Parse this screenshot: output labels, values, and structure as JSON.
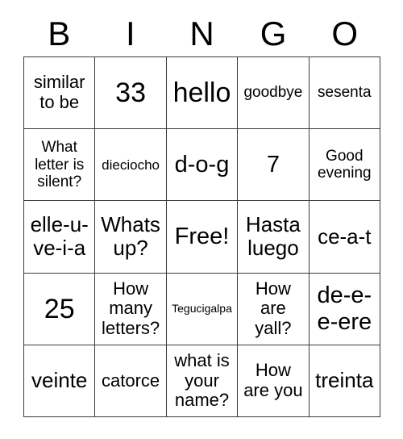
{
  "card": {
    "type": "bingo-card",
    "columns": 5,
    "rows": 5,
    "background_color": "#ffffff",
    "text_color": "#000000",
    "border_color": "#3a3a3a"
  },
  "header": {
    "letters": [
      "B",
      "I",
      "N",
      "G",
      "O"
    ]
  },
  "grid": {
    "rows": [
      [
        {
          "text": "similar to be",
          "size": "lg"
        },
        {
          "text": "33",
          "size": "huge"
        },
        {
          "text": "hello",
          "size": "huge"
        },
        {
          "text": "goodbye",
          "size": "md"
        },
        {
          "text": "sesenta",
          "size": "md"
        }
      ],
      [
        {
          "text": "What letter is silent?",
          "size": "md"
        },
        {
          "text": "dieciocho",
          "size": "sm"
        },
        {
          "text": "d-o-g",
          "size": "xxl"
        },
        {
          "text": "7",
          "size": "xxl"
        },
        {
          "text": "Good evening",
          "size": "md"
        }
      ],
      [
        {
          "text": "elle-u-ve-i-a",
          "size": "xl"
        },
        {
          "text": "Whats up?",
          "size": "xl"
        },
        {
          "text": "Free!",
          "size": "xxl"
        },
        {
          "text": "Hasta luego",
          "size": "xl"
        },
        {
          "text": "ce-a-t",
          "size": "xl"
        }
      ],
      [
        {
          "text": "25",
          "size": "huge"
        },
        {
          "text": "How many letters?",
          "size": "lg"
        },
        {
          "text": "Tegucigalpa",
          "size": "xs"
        },
        {
          "text": "How are yall?",
          "size": "lg"
        },
        {
          "text": "de-e-e-ere",
          "size": "xxl"
        }
      ],
      [
        {
          "text": "veinte",
          "size": "xl"
        },
        {
          "text": "catorce",
          "size": "lg"
        },
        {
          "text": "what is your name?",
          "size": "lg"
        },
        {
          "text": "How are you",
          "size": "lg"
        },
        {
          "text": "treinta",
          "size": "xl"
        }
      ]
    ]
  }
}
